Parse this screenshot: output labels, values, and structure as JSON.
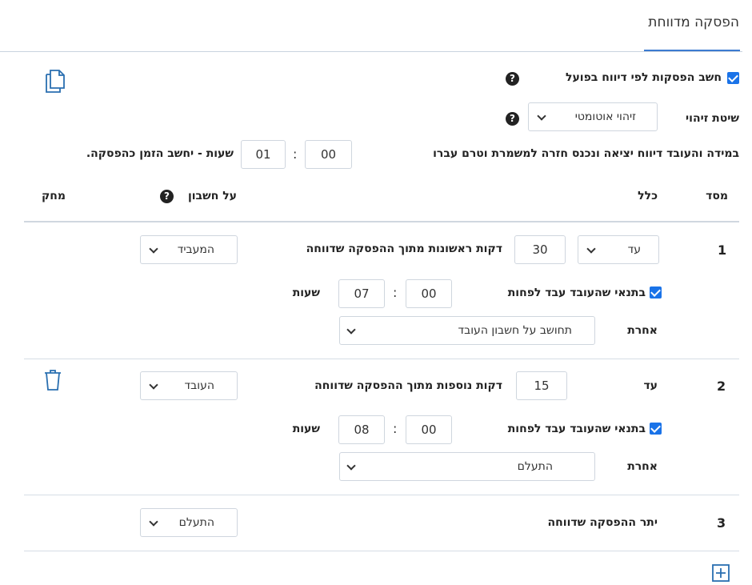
{
  "tab": {
    "title": "הפסקה מדווחת"
  },
  "settings": {
    "calc_breaks_label": "חשב הפסקות לפי דיווח בפועל",
    "calc_breaks_checked": true,
    "detection_label": "שיטת זיהוי",
    "detection_value": "זיהוי אוטומטי",
    "rule_text_before": "במידה והעובד דיווח יציאה ונכנס חזרה למשמרת וטרם עברו",
    "rule_hours": "01",
    "rule_minutes": "00",
    "rule_text_after": "שעות - יחשב הזמן כהפסקה.",
    "colon": ":"
  },
  "table": {
    "headers": {
      "index": "מסד",
      "rule": "כלל",
      "account": "על חשבון",
      "delete": "מחק"
    },
    "rows": [
      {
        "index": "1",
        "condition": "עד",
        "minutes": "30",
        "description": "דקות ראשונות מתוך ההפסקה שדווחה",
        "account": "המעביד",
        "min_work_label": "בתנאי שהעובד עבד לפחות",
        "min_work_checked": true,
        "min_hours": "07",
        "min_minutes": "00",
        "hours_label": "שעות",
        "else_label": "אחרת",
        "else_value": "תחושב על חשבון העובד"
      },
      {
        "index": "2",
        "condition": "עד",
        "minutes": "15",
        "description": "דקות נוספות מתוך ההפסקה שדווחה",
        "account": "העובד",
        "min_work_label": "בתנאי שהעובד עבד לפחות",
        "min_work_checked": true,
        "min_hours": "08",
        "min_minutes": "00",
        "hours_label": "שעות",
        "else_label": "אחרת",
        "else_value": "התעלם"
      },
      {
        "index": "3",
        "description": "יתר ההפסקה שדווחה",
        "account": "התעלם"
      }
    ]
  },
  "icons": {
    "copy": "copy-icon",
    "delete": "trash-icon",
    "add": "plus-square-icon",
    "help": "question-circle-icon",
    "help_glyph": "?"
  },
  "colors": {
    "accent": "#1a73e8",
    "tab_underline": "#3c7bd0"
  }
}
